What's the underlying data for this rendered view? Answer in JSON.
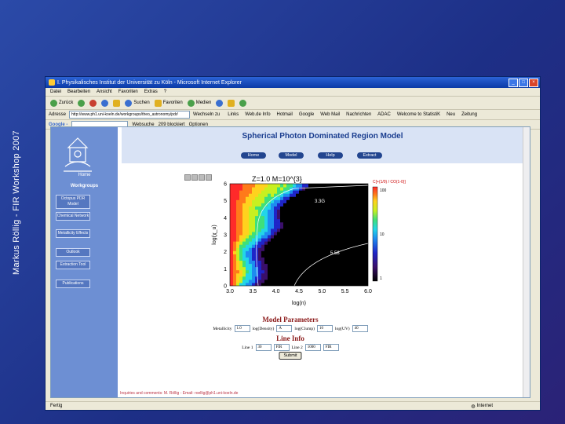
{
  "slide": {
    "side_caption": "Markus Röllig - FIR Workshop 2007"
  },
  "browser": {
    "title": "I. Physikalisches Institut der Universität zu Köln - Microsoft Internet Explorer",
    "menu": [
      "Datei",
      "Bearbeiten",
      "Ansicht",
      "Favoriten",
      "Extras",
      "?"
    ],
    "toolbar": {
      "back": "Zurück",
      "search": "Suchen",
      "favorites": "Favoriten",
      "media": "Medien"
    },
    "address_value": "http://www.ph1.uni-koeln.de/workgroups/theo_astronomy/pdr/",
    "address_label": "Adresse",
    "go_label": "Wechseln zu",
    "links": [
      "Links",
      "Web.de Info",
      "Hotmail",
      "Google",
      "Web Mail",
      "Nachrichten",
      "ADAC",
      "Welcome to StatistiK",
      "Neu",
      "Zeitung"
    ],
    "google": {
      "logo": "Google -",
      "search": "Websuche",
      "blocked": "209 blockiert",
      "options": "Optionen"
    },
    "status_text": "Fertig",
    "zone_text": "Internet"
  },
  "page": {
    "title": "Spherical Photon Dominated Region Model",
    "nav": [
      "Home",
      "Model",
      "Help",
      "Extract"
    ],
    "sidebar": {
      "logo_caption": "Home",
      "heading": "Workgroups",
      "buttons": [
        "Octopus PDR Model",
        "Chemical Network",
        "Metallicity Effects",
        "Outlook",
        "Extraction Tool",
        "Publications"
      ]
    },
    "model_parameters_title": "Model Parameters",
    "line_info_title": "Line Info",
    "params": {
      "metallicity_label": "Metallicity",
      "metallicity_value": "1.0",
      "density_label": "log(Density)",
      "density_value": "A",
      "clump_label": "log(Clump)",
      "clump_value": "10",
      "uv_label": "log(UV)",
      "uv_value": "40"
    },
    "line_info": {
      "line1_label": "Line 1",
      "line1_value": "30",
      "line1_unit": "FIR",
      "line2_label": "Line 2",
      "line2_value": "1000",
      "line2_unit": "FIR"
    },
    "submit_label": "Submit",
    "footer_text": "Inquiries and comments: M. Röllig - Email: roellig@ph1.uni-koeln.de"
  },
  "chart_data": {
    "type": "heatmap",
    "title": "Z=1.0   M=10^{3}",
    "top_right_label": "C[+(1/0) / CO(1-0)]",
    "xlabel": "log(n)",
    "ylabel": "log(χ_u)",
    "xlim": [
      3.0,
      6.0
    ],
    "ylim": [
      0,
      6
    ],
    "x_ticks": [
      "3.0",
      "3.5",
      "4.0",
      "4.5",
      "5.0",
      "5.5",
      "6.0"
    ],
    "y_ticks": [
      "0",
      "1",
      "2",
      "3",
      "4",
      "5",
      "6"
    ],
    "colorbar_ticks": [
      "100",
      "10",
      "1"
    ],
    "colormap": [
      "#000000",
      "#3a0f6a",
      "#1f25c8",
      "#1e8cf0",
      "#22d6e8",
      "#3fe07a",
      "#c8f020",
      "#ffd21e",
      "#ff7a1a",
      "#ff2a2a",
      "#ffffff"
    ],
    "contours": [
      {
        "label": "3.3G"
      },
      {
        "label": "5.58"
      }
    ]
  }
}
